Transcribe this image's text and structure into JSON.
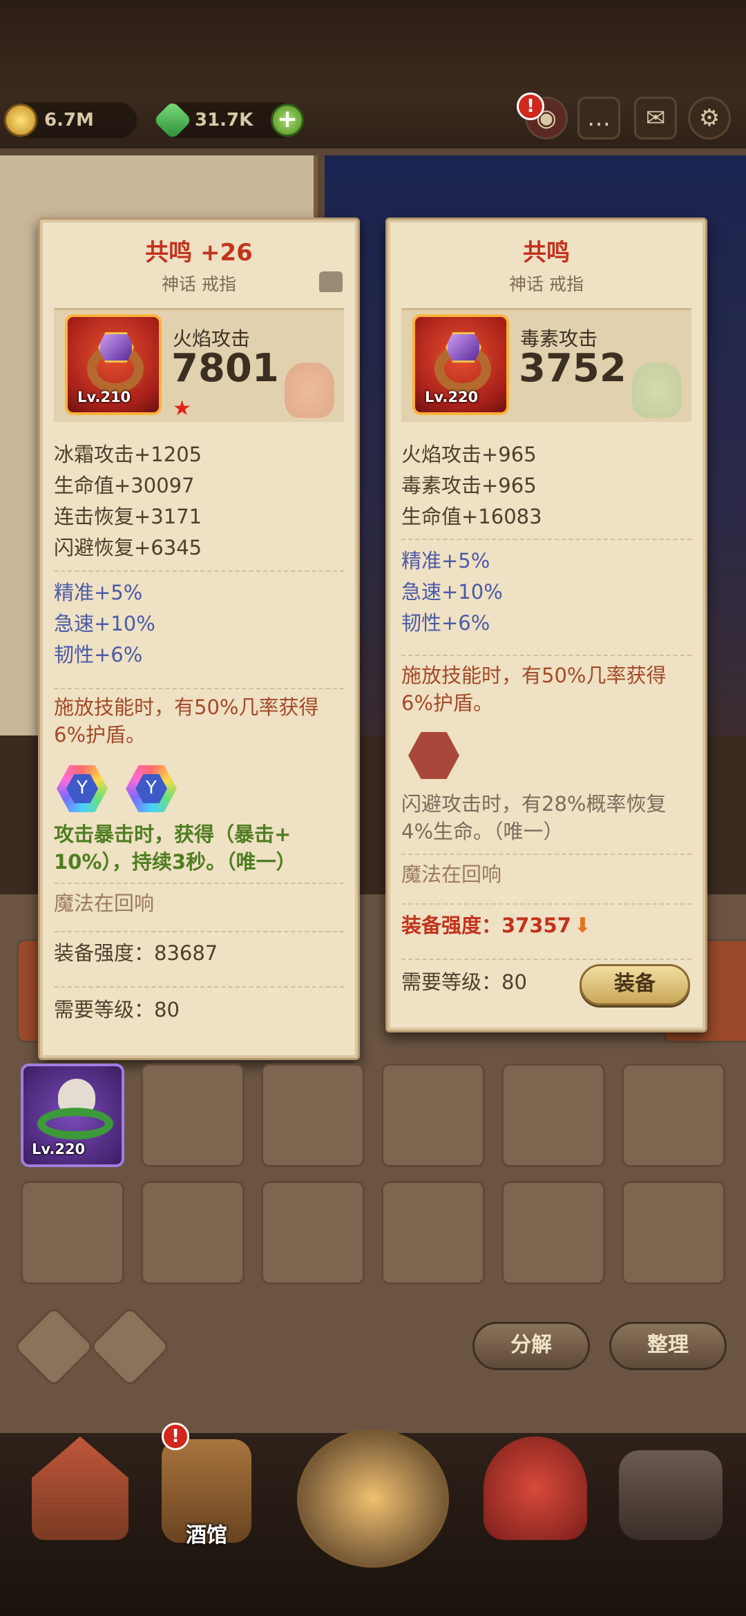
{
  "topbar": {
    "gold": "6.7M",
    "gems": "31.7K",
    "plus": "+",
    "alert": "!",
    "icons": [
      "store-alert-icon",
      "chat-icon",
      "mail-icon",
      "settings-icon"
    ]
  },
  "left_card": {
    "title": "共鸣 +26",
    "subtitle": "神话 戒指",
    "level": "Lv.210",
    "main_stat_name": "火焰攻击",
    "main_stat_value": "7801",
    "base_stats": [
      "冰霜攻击+1205",
      "生命值+30097",
      "连击恢复+3171",
      "闪避恢复+6345"
    ],
    "bonus_stats": [
      "精准+5%",
      "急速+10%",
      "韧性+6%"
    ],
    "skill_lines": [
      "施放技能时，有50%几率获得",
      "6%护盾。"
    ],
    "gem_effect_lines": [
      "攻击暴击时，获得（暴击+",
      "10%），持续3秒。（唯一）"
    ],
    "echo": "魔法在回响",
    "power": "装备强度：83687",
    "req_level": "需要等级：80"
  },
  "right_card": {
    "title": "共鸣",
    "subtitle": "神话 戒指",
    "level": "Lv.220",
    "main_stat_name": "毒素攻击",
    "main_stat_value": "3752",
    "base_stats": [
      "火焰攻击+965",
      "毒素攻击+965",
      "生命值+16083"
    ],
    "bonus_stats": [
      "精准+5%",
      "急速+10%",
      "韧性+6%"
    ],
    "skill_lines": [
      "施放技能时，有50%几率获得",
      "6%护盾。"
    ],
    "gem_effect_lines": [
      "闪避攻击时，有28%概率恢复",
      "4%生命。（唯一）"
    ],
    "echo": "魔法在回响",
    "power": "装备强度：37357",
    "req_level": "需要等级：80",
    "equip_label": "装备"
  },
  "inventory": {
    "item_level": "Lv.220",
    "decompose_label": "分解",
    "sort_label": "整理"
  },
  "bottom_nav": {
    "tavern_label": "酒馆",
    "alert": "!"
  },
  "colors": {
    "card_bg": "#efe1c3",
    "title_red": "#c2331e",
    "bonus_blue": "#4b5aa8",
    "skill_red": "#a34a2a",
    "gem_green": "#4f7d22"
  }
}
